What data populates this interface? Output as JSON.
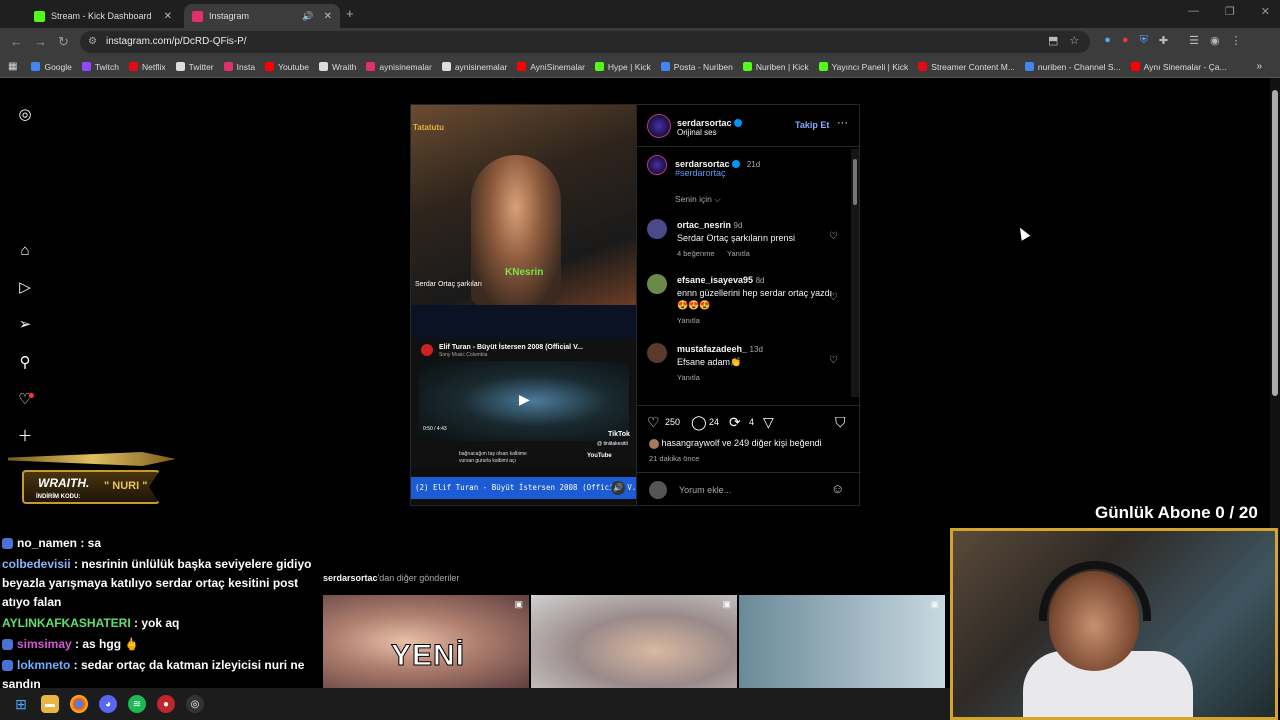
{
  "browser": {
    "tabs": [
      {
        "label": "Stream - Kick Dashboard",
        "active": false,
        "favicon_color": "#53fc18"
      },
      {
        "label": "Instagram",
        "active": true,
        "favicon_color": "#e1306c"
      }
    ],
    "url": "instagram.com/p/DcRD-QFis-P/",
    "bookmarks": [
      {
        "label": "Google",
        "color": "#4285f4"
      },
      {
        "label": "Twitch",
        "color": "#9146ff"
      },
      {
        "label": "Netflix",
        "color": "#e50914"
      },
      {
        "label": "Twitter",
        "color": "#dddddd"
      },
      {
        "label": "Insta",
        "color": "#e1306c"
      },
      {
        "label": "Youtube",
        "color": "#ff0000"
      },
      {
        "label": "Wraith",
        "color": "#dddddd"
      },
      {
        "label": "aynisinemalar",
        "color": "#e1306c"
      },
      {
        "label": "aynisinemalar",
        "color": "#dddddd"
      },
      {
        "label": "AyniSinemalar",
        "color": "#ff0000"
      },
      {
        "label": "Hype | Kick",
        "color": "#53fc18"
      },
      {
        "label": "Posta - Nuriben",
        "color": "#4285f4"
      },
      {
        "label": "Nuriben | Kick",
        "color": "#53fc18"
      },
      {
        "label": "Yayıncı Paneli | Kick",
        "color": "#53fc18"
      },
      {
        "label": "Streamer Content M...",
        "color": "#e50914"
      },
      {
        "label": "nuriben - Channel S...",
        "color": "#4285f4"
      },
      {
        "label": "Aynı Sinemalar - Ça...",
        "color": "#ff0000"
      }
    ]
  },
  "post": {
    "author": "serdarsortac",
    "audio": "Orijinal ses",
    "follow": "Takip Et",
    "more": "···",
    "caption_user": "serdarsortac",
    "caption_age": "21d",
    "caption_tag": "#serdarortaç",
    "sort_label": "Senin için",
    "comments": [
      {
        "user": "ortac_nesrin",
        "age": "9d",
        "text": "Serdar Ortaç şarkıların prensi",
        "likes": "4 beğenme",
        "reply": "Yanıtla",
        "avatar_color": "#4a4a8a"
      },
      {
        "user": "efsane_isayeva95",
        "age": "8d",
        "text": "ennn güzellerini hep serdar ortaç yazdı😍😍😍",
        "likes": "",
        "reply": "Yanıtla",
        "avatar_color": "#6a8a4a"
      },
      {
        "user": "mustafazadeeh_",
        "age": "13d",
        "text": "Efsane adam👏",
        "likes": "",
        "reply": "Yanıtla",
        "avatar_color": "#5a3a2a"
      }
    ],
    "like_count": "250",
    "comment_count": "24",
    "share_count": "4",
    "liked_by": "hasangraywolf ve 249 diğer kişi beğendi",
    "time_ago": "21 dakika önce",
    "comment_placeholder": "Yorum ekle...",
    "media": {
      "top_caption": "Serdar Ortaç şarkıları",
      "top_brand": "KNesrin",
      "top_tag": "Tatatutu",
      "yt_title": "Elif Turan - Büyüt İstersen 2008 (Official V...",
      "yt_channel": "Sony Music Columbia",
      "yt_time": "0:50 / 4:43",
      "yt_lyrics_1": "bağrıacağım taş olsan kalbime",
      "yt_lyrics_2": "vursan gururla kalbimi açı",
      "yt_logo": "YouTube",
      "tiktok": "TikTok",
      "tiktok_handle": "@ tiniitakesitö",
      "marquee": "(2) Elif Turan - Büyüt İstersen 2008 (Official V..."
    }
  },
  "more_posts": {
    "heading_user": "serdarsortac",
    "heading_rest": "'dan diğer gönderiler",
    "first_overlay": "YENİ"
  },
  "overlay": {
    "sponsor_title": "WRAITH.",
    "sponsor_nuri": "\" NURI \"",
    "sponsor_code": "İNDİRİM KODU:",
    "daily_subs": "Günlük Abone 0 / 20",
    "chat": [
      {
        "user": "no_namen",
        "color": "#ffffff",
        "msg": " : sa",
        "badge": true
      },
      {
        "user": "colbedevisii",
        "color": "#8ab4f8",
        "msg": " : nesrinin ünlülük başka seviyelere gidiyo beyazla yarışmaya katılıyo serdar ortaç kesitini post atıyo falan",
        "badge": false
      },
      {
        "user": "AYLINKAFKASHATERI",
        "color": "#5ee06a",
        "msg": " : yok aq",
        "badge": false
      },
      {
        "user": "simsimay",
        "color": "#d35ad3",
        "msg": " : as hgg 🖕",
        "badge": true
      },
      {
        "user": "lokmneto",
        "color": "#6ab0ff",
        "msg": " : sedar ortaç da katman izleyicisi nuri ne sandın",
        "badge": true
      }
    ]
  }
}
